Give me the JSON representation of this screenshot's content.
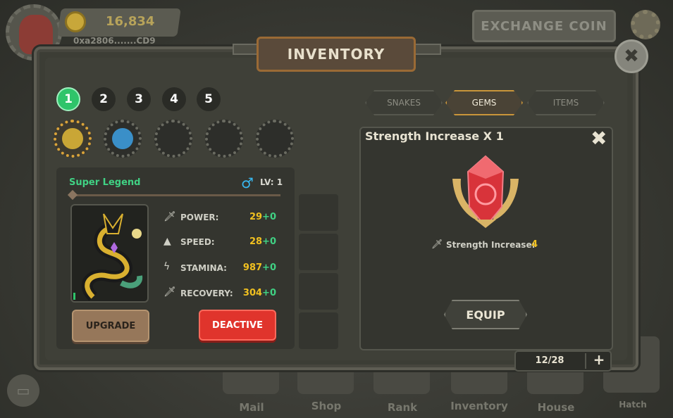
{
  "hud": {
    "coins": "16,834",
    "wallet": "0xa2806.......CD9",
    "exchange_label": "EXCHANGE COIN"
  },
  "inventory": {
    "title": "INVENTORY",
    "team_tabs": [
      "1",
      "2",
      "3",
      "4",
      "5"
    ],
    "active_team": 1
  },
  "snake": {
    "rarity": "Super Legend",
    "gender_symbol": "♂",
    "level": "LV: 1",
    "stats": [
      {
        "label": "POWER:",
        "base": "29",
        "bonus": "+0",
        "icon": "sword-icon"
      },
      {
        "label": "SPEED:",
        "base": "28",
        "bonus": "+0",
        "icon": "rocket-icon"
      },
      {
        "label": "STAMINA:",
        "base": "987",
        "bonus": "+0",
        "icon": "lightning-icon"
      },
      {
        "label": "RECOVERY:",
        "base": "304",
        "bonus": "+0",
        "icon": "sword-icon"
      }
    ],
    "upgrade_label": "UPGRADE",
    "deactive_label": "DEACTIVE"
  },
  "categories": {
    "tabs": [
      "SNAKES",
      "GEMS",
      "ITEMS"
    ],
    "active": "GEMS"
  },
  "gem": {
    "title": "Strength Increase X 1",
    "effect_label": "Strength Increase:",
    "effect_value": "4",
    "equip_label": "EQUIP"
  },
  "pager": {
    "count": "12/28",
    "add_symbol": "+"
  },
  "bottom_nav": [
    "Mail",
    "Shop",
    "Rank",
    "Inventory",
    "House",
    "Hatch"
  ],
  "colors": {
    "accent_green": "#2fc46a",
    "deactive_red": "#e0342c",
    "stat_gold": "#f0c020",
    "gem_red": "#d8333a"
  }
}
